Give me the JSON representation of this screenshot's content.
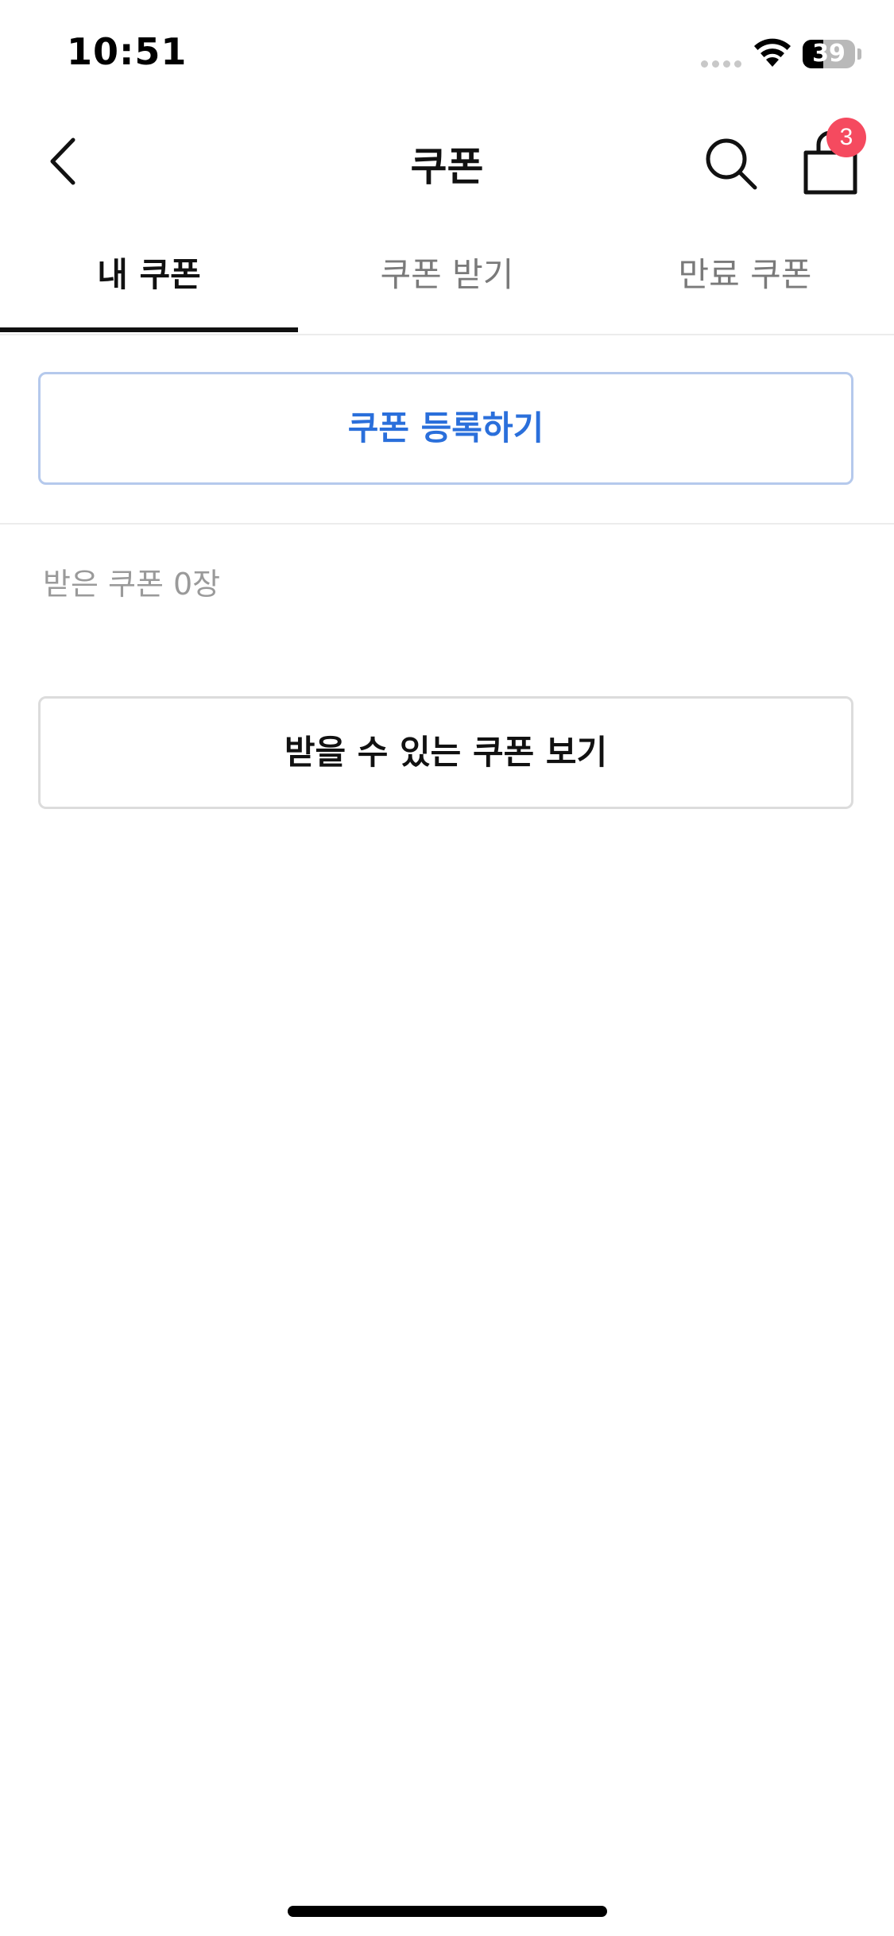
{
  "status_bar": {
    "time": "10:51",
    "battery_level": "39",
    "battery_fraction": 0.39
  },
  "header": {
    "title": "쿠폰",
    "back_icon": "chevron-left-icon",
    "search_icon": "search-icon",
    "cart_icon": "shopping-bag-icon",
    "cart_badge_count": "3",
    "badge_color": "#f54a5f"
  },
  "tabs": [
    {
      "label": "내 쿠폰",
      "active": true
    },
    {
      "label": "쿠폰 받기",
      "active": false
    },
    {
      "label": "만료 쿠폰",
      "active": false
    }
  ],
  "content": {
    "register_button_label": "쿠폰 등록하기",
    "coupon_count_text": "받은 쿠폰 0장",
    "view_coupons_button_label": "받을 수 있는 쿠폰 보기"
  },
  "colors": {
    "accent": "#2a6fdb",
    "accent_border": "#b5c9ec",
    "muted_text": "#9a9a9a"
  }
}
